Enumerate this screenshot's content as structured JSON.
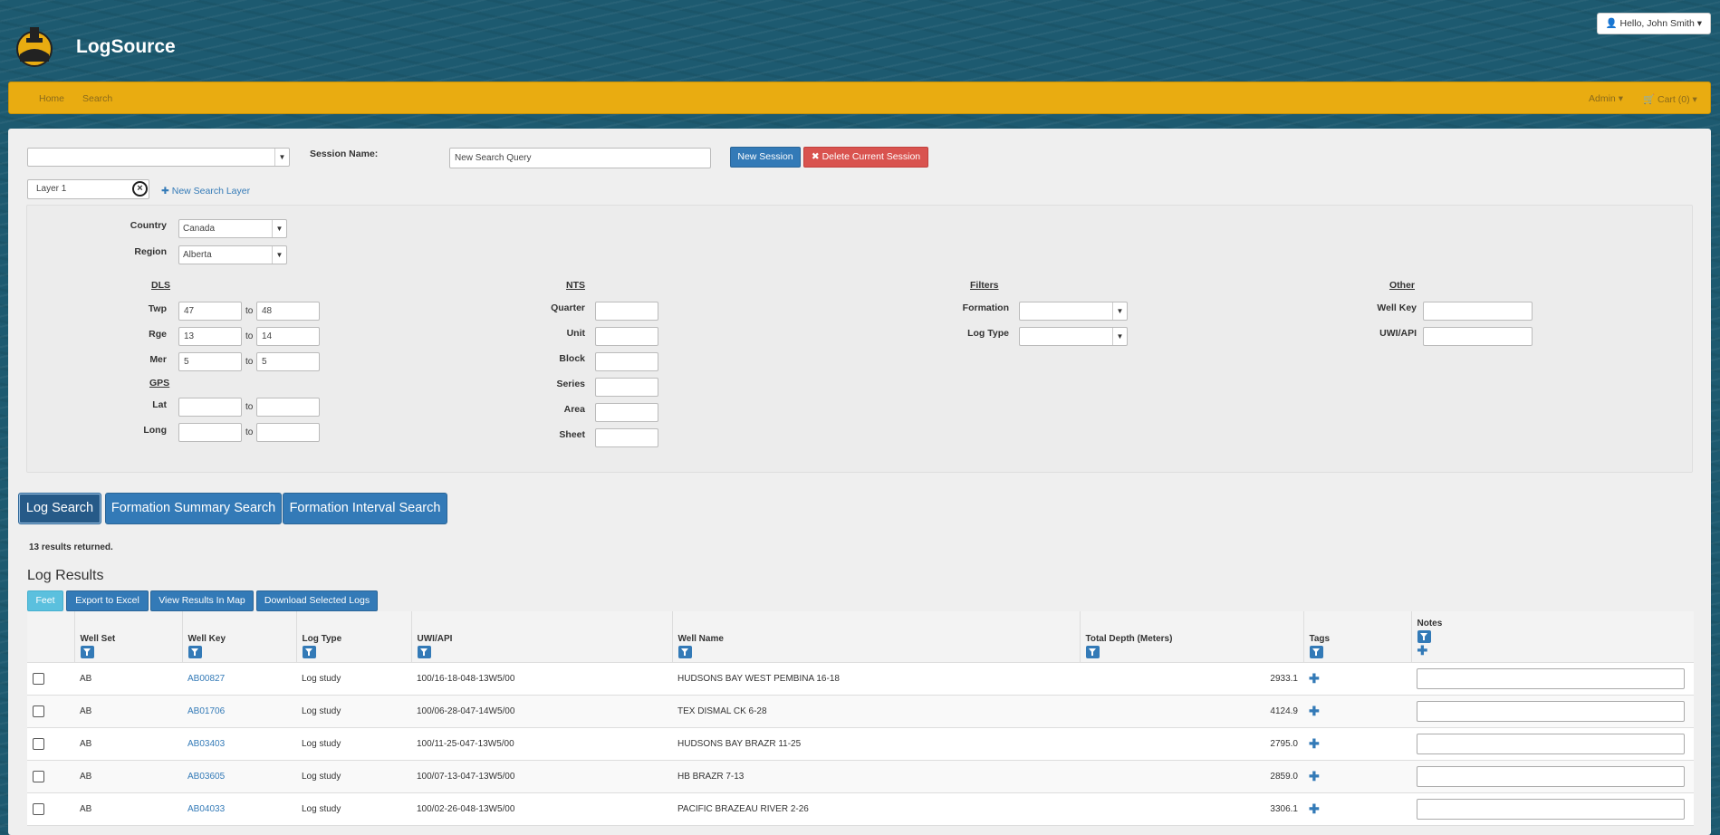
{
  "app": {
    "title": "LogSource",
    "user_menu": "Hello, John Smith",
    "caret": "▾"
  },
  "nav": {
    "home": "Home",
    "search": "Search",
    "admin": "Admin",
    "cart": "Cart (0)"
  },
  "session": {
    "select_value": "",
    "session_name_label": "Session Name:",
    "session_name_value": "New Search Query",
    "new_session": "New Session",
    "delete_session": "Delete Current Session",
    "layer_name": "Layer 1",
    "new_layer": "New Search Layer"
  },
  "location": {
    "country_label": "Country",
    "country_value": "Canada",
    "region_label": "Region",
    "region_value": "Alberta"
  },
  "dls": {
    "title": "DLS",
    "twp_label": "Twp",
    "twp_from": "47",
    "twp_to": "48",
    "rge_label": "Rge",
    "rge_from": "13",
    "rge_to": "14",
    "mer_label": "Mer",
    "mer_from": "5",
    "mer_to": "5",
    "to": "to"
  },
  "gps": {
    "title": "GPS",
    "lat_label": "Lat",
    "long_label": "Long",
    "to": "to"
  },
  "nts": {
    "title": "NTS",
    "quarter": "Quarter",
    "unit": "Unit",
    "block": "Block",
    "series": "Series",
    "area": "Area",
    "sheet": "Sheet"
  },
  "filters": {
    "title": "Filters",
    "formation": "Formation",
    "log_type": "Log Type"
  },
  "other": {
    "title": "Other",
    "well_key": "Well Key",
    "uwi_api": "UWI/API"
  },
  "tabs": [
    "Log Search",
    "Formation Summary Search",
    "Formation Interval Search"
  ],
  "results": {
    "count_text": "13 results returned.",
    "heading": "Log Results",
    "buttons": [
      "Feet",
      "Export to Excel",
      "View Results In Map",
      "Download Selected Logs"
    ],
    "columns": [
      "Well Set",
      "Well Key",
      "Log Type",
      "UWI/API",
      "Well Name",
      "Total Depth (Meters)",
      "Tags",
      "Notes"
    ],
    "rows": [
      {
        "well_set": "AB",
        "well_key": "AB00827",
        "log_type": "Log study",
        "uwi": "100/16-18-048-13W5/00",
        "well_name": "HUDSONS BAY WEST PEMBINA 16-18",
        "depth": "2933.1"
      },
      {
        "well_set": "AB",
        "well_key": "AB01706",
        "log_type": "Log study",
        "uwi": "100/06-28-047-14W5/00",
        "well_name": "TEX DISMAL CK 6-28",
        "depth": "4124.9"
      },
      {
        "well_set": "AB",
        "well_key": "AB03403",
        "log_type": "Log study",
        "uwi": "100/11-25-047-13W5/00",
        "well_name": "HUDSONS BAY BRAZR 11-25",
        "depth": "2795.0"
      },
      {
        "well_set": "AB",
        "well_key": "AB03605",
        "log_type": "Log study",
        "uwi": "100/07-13-047-13W5/00",
        "well_name": "HB BRAZR 7-13",
        "depth": "2859.0"
      },
      {
        "well_set": "AB",
        "well_key": "AB04033",
        "log_type": "Log study",
        "uwi": "100/02-26-048-13W5/00",
        "well_name": "PACIFIC BRAZEAU RIVER 2-26",
        "depth": "3306.1"
      }
    ]
  }
}
